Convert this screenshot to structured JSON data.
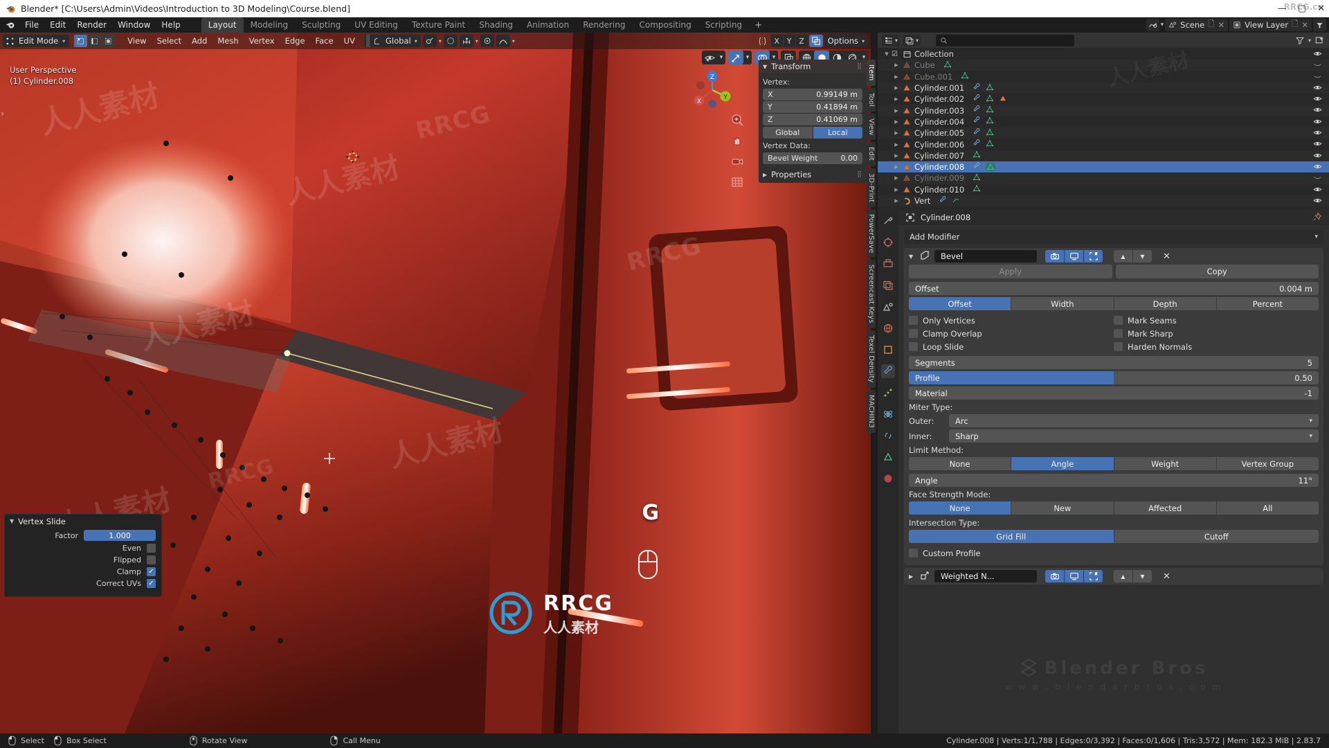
{
  "titlebar": {
    "text": "Blender* [C:\\Users\\Admin\\Videos\\Introduction to 3D Modeling\\Course.blend]",
    "minimize": "—",
    "maximize": "▢",
    "close": "✕",
    "corner_watermark": "RRCG.cn"
  },
  "topbar": {
    "menus": [
      "File",
      "Edit",
      "Render",
      "Window",
      "Help"
    ],
    "workspaces": [
      "Layout",
      "Modeling",
      "Sculpting",
      "UV Editing",
      "Texture Paint",
      "Shading",
      "Animation",
      "Rendering",
      "Compositing",
      "Scripting"
    ],
    "active_workspace": "Layout",
    "add_workspace": "+",
    "scene_name": "Scene",
    "view_layer_name": "View Layer"
  },
  "viewport": {
    "mode": "Edit Mode",
    "menus": [
      "View",
      "Select",
      "Add",
      "Mesh",
      "Vertex",
      "Edge",
      "Face",
      "UV"
    ],
    "transform_orientation": "Global",
    "options_label": "Options",
    "axis_locks": [
      "X",
      "Y",
      "Z"
    ],
    "overlay_text_line1": "User Perspective",
    "overlay_text_line2": "(1) Cylinder.008",
    "gizmo_axes": {
      "x": "X",
      "y": "Y",
      "z": "Z"
    },
    "key_hint": "G"
  },
  "npanel": {
    "title": "Transform",
    "vertex_label": "Vertex:",
    "fields": [
      {
        "key": "X",
        "value": "0.99149 m"
      },
      {
        "key": "Y",
        "value": "0.41894 m"
      },
      {
        "key": "Z",
        "value": "0.41069 m"
      }
    ],
    "space_options": [
      "Global",
      "Local"
    ],
    "space_active": "Local",
    "vertex_data_label": "Vertex Data:",
    "bevel_weight_label": "Bevel Weight",
    "bevel_weight_value": "0.00",
    "properties_label": "Properties",
    "tabs": [
      "Item",
      "Tool",
      "View",
      "Edit",
      "3D-Print",
      "PowerSave",
      "Screencast Keys",
      "Texel Density",
      "MACHIN3"
    ],
    "active_tab": "Item"
  },
  "operator_panel": {
    "title": "Vertex Slide",
    "factor_label": "Factor",
    "factor_value": "1.000",
    "checkboxes": [
      {
        "label": "Even",
        "checked": false
      },
      {
        "label": "Flipped",
        "checked": false
      },
      {
        "label": "Clamp",
        "checked": true
      },
      {
        "label": "Correct UVs",
        "checked": true
      }
    ]
  },
  "outliner": {
    "search_placeholder": "",
    "rows": [
      {
        "name": "Collection",
        "indent": 0,
        "type": "collection",
        "dim": false,
        "selected": false,
        "hidden": false,
        "badges": []
      },
      {
        "name": "Cube",
        "indent": 1,
        "type": "mesh",
        "dim": true,
        "selected": false,
        "hidden": true,
        "badges": [
          "mesh-data"
        ]
      },
      {
        "name": "Cube.001",
        "indent": 1,
        "type": "mesh",
        "dim": true,
        "selected": false,
        "hidden": true,
        "badges": [
          "mesh-data"
        ]
      },
      {
        "name": "Cylinder.001",
        "indent": 1,
        "type": "mesh",
        "dim": false,
        "selected": false,
        "hidden": false,
        "badges": [
          "modifier",
          "mesh-data"
        ]
      },
      {
        "name": "Cylinder.002",
        "indent": 1,
        "type": "mesh",
        "dim": false,
        "selected": false,
        "hidden": false,
        "badges": [
          "modifier",
          "mesh-data",
          "child-mesh"
        ]
      },
      {
        "name": "Cylinder.003",
        "indent": 1,
        "type": "mesh",
        "dim": false,
        "selected": false,
        "hidden": false,
        "badges": [
          "modifier",
          "mesh-data"
        ]
      },
      {
        "name": "Cylinder.004",
        "indent": 1,
        "type": "mesh",
        "dim": false,
        "selected": false,
        "hidden": false,
        "badges": [
          "modifier",
          "mesh-data"
        ]
      },
      {
        "name": "Cylinder.005",
        "indent": 1,
        "type": "mesh",
        "dim": false,
        "selected": false,
        "hidden": false,
        "badges": [
          "modifier",
          "mesh-data"
        ]
      },
      {
        "name": "Cylinder.006",
        "indent": 1,
        "type": "mesh",
        "dim": false,
        "selected": false,
        "hidden": false,
        "badges": [
          "modifier",
          "mesh-data"
        ]
      },
      {
        "name": "Cylinder.007",
        "indent": 1,
        "type": "mesh",
        "dim": false,
        "selected": false,
        "hidden": false,
        "badges": [
          "mesh-data"
        ]
      },
      {
        "name": "Cylinder.008",
        "indent": 1,
        "type": "mesh",
        "dim": false,
        "selected": true,
        "hidden": false,
        "badges": [
          "modifier",
          "mesh-data-active"
        ]
      },
      {
        "name": "Cylinder.009",
        "indent": 1,
        "type": "mesh",
        "dim": true,
        "selected": false,
        "hidden": true,
        "badges": [
          "mesh-data"
        ]
      },
      {
        "name": "Cylinder.010",
        "indent": 1,
        "type": "mesh",
        "dim": false,
        "selected": false,
        "hidden": false,
        "badges": [
          "mesh-data"
        ]
      },
      {
        "name": "Vert",
        "indent": 1,
        "type": "curve",
        "dim": false,
        "selected": false,
        "hidden": false,
        "badges": [
          "modifier",
          "curve-data"
        ]
      }
    ]
  },
  "properties": {
    "breadcrumb_object": "Cylinder.008",
    "add_modifier_label": "Add Modifier",
    "modifier": {
      "name": "Bevel",
      "apply_label": "Apply",
      "copy_label": "Copy",
      "offset_label": "Offset",
      "offset_value": "0.004 m",
      "width_type_options": [
        "Offset",
        "Width",
        "Depth",
        "Percent"
      ],
      "width_type_active": "Offset",
      "checkboxes_left": [
        {
          "label": "Only Vertices",
          "checked": false
        },
        {
          "label": "Clamp Overlap",
          "checked": false
        },
        {
          "label": "Loop Slide",
          "checked": false
        }
      ],
      "checkboxes_right": [
        {
          "label": "Mark Seams",
          "checked": false
        },
        {
          "label": "Mark Sharp",
          "checked": false
        },
        {
          "label": "Harden Normals",
          "checked": false
        }
      ],
      "segments_label": "Segments",
      "segments_value": "5",
      "profile_label": "Profile",
      "profile_value": "0.50",
      "material_label": "Material",
      "material_value": "-1",
      "miter_type_label": "Miter Type:",
      "outer_label": "Outer:",
      "outer_value": "Arc",
      "inner_label": "Inner:",
      "inner_value": "Sharp",
      "limit_method_label": "Limit Method:",
      "limit_method_options": [
        "None",
        "Angle",
        "Weight",
        "Vertex Group"
      ],
      "limit_method_active": "Angle",
      "angle_label": "Angle",
      "angle_value": "11°",
      "face_strength_label": "Face Strength Mode:",
      "face_strength_options": [
        "None",
        "New",
        "Affected",
        "All"
      ],
      "face_strength_active": "None",
      "intersection_label": "Intersection Type:",
      "intersection_options": [
        "Grid Fill",
        "Cutoff"
      ],
      "intersection_active": "Grid Fill",
      "custom_profile_label": "Custom Profile",
      "custom_profile_checked": false
    },
    "modifier2_name": "Weighted N...",
    "watermark_line1": "Blender Bros",
    "watermark_line2": "w w w . b l e n d e r b r o s . c o m"
  },
  "statusbar": {
    "items": [
      {
        "icon": "mouse-left-icon",
        "label": "Select"
      },
      {
        "icon": "mouse-left-drag-icon",
        "label": "Box Select"
      },
      {
        "icon": "mouse-middle-icon",
        "label": "Rotate View"
      },
      {
        "icon": "mouse-right-icon",
        "label": "Call Menu"
      }
    ],
    "stats": "Cylinder.008 | Verts:1/1,788 | Edges:0/3,392 | Faces:0/1,606 | Tris:3,572 | Mem: 182.3 MiB | 2.83.7"
  },
  "watermarks": {
    "cn_text": "人人素材",
    "rrcg": "RRCG",
    "center_sub": "人人素材"
  },
  "colors": {
    "accent_blue": "#4772b3",
    "panel_bg": "#303030",
    "editor_bg": "#282828",
    "header_bg": "#1d1d1d",
    "viewport_red": "#b8342a"
  }
}
